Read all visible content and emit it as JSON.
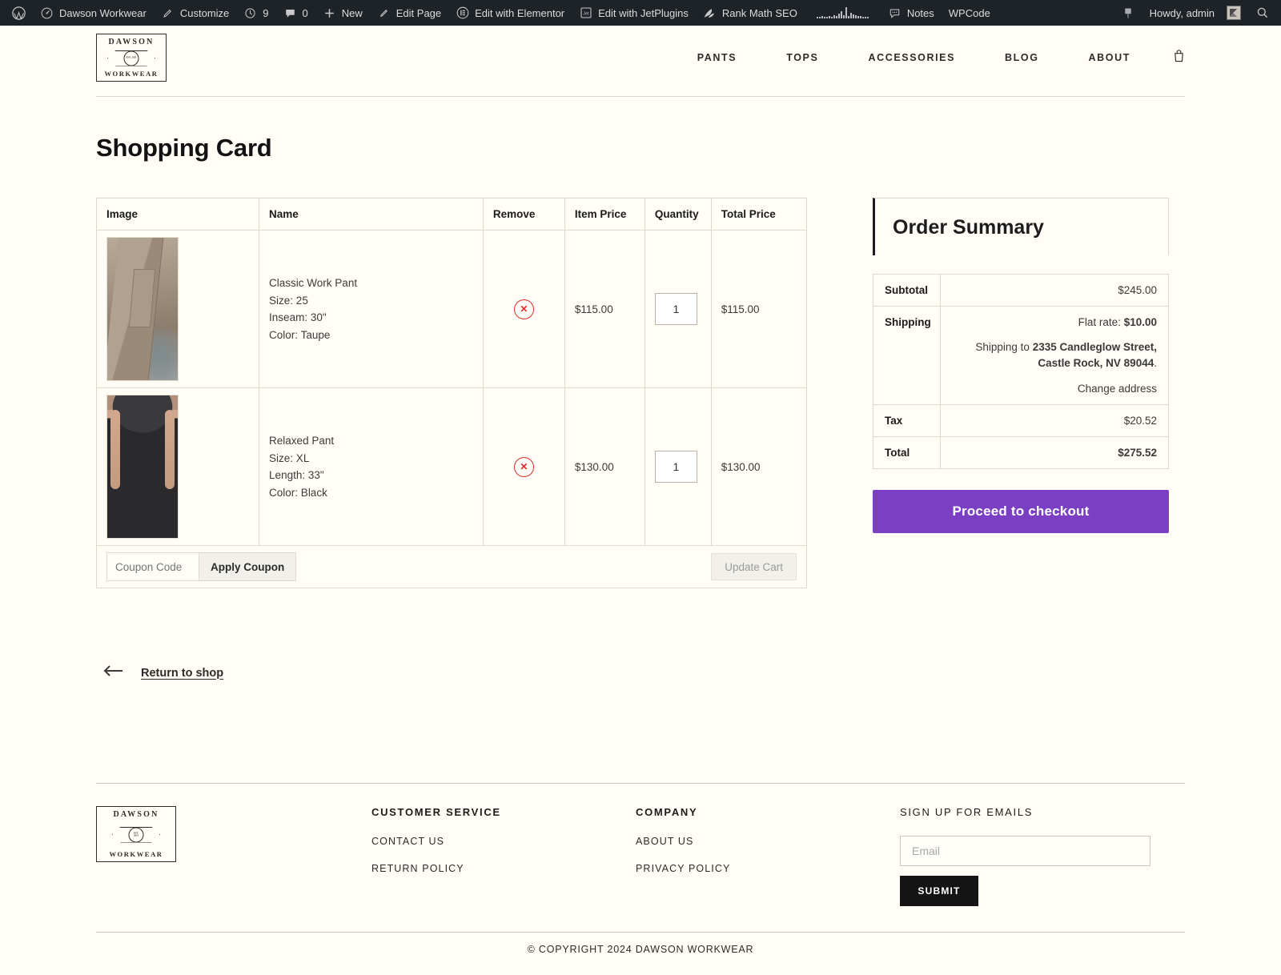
{
  "adminbar": {
    "left_items": [
      {
        "icon": "wordpress-logo-icon",
        "label": ""
      },
      {
        "icon": "dashboard-icon",
        "label": "Dawson Workwear"
      },
      {
        "icon": "paintbrush-icon",
        "label": "Customize"
      },
      {
        "icon": "updates-icon",
        "label": "9"
      },
      {
        "icon": "comment-bubble-icon",
        "label": "0"
      },
      {
        "icon": "plus-icon",
        "label": "New"
      },
      {
        "icon": "pencil-icon",
        "label": "Edit Page"
      },
      {
        "icon": "elementor-icon",
        "label": "Edit with Elementor"
      },
      {
        "icon": "jetplugins-icon",
        "label": "Edit with JetPlugins"
      },
      {
        "icon": "rankmath-icon",
        "label": "Rank Math SEO"
      },
      {
        "icon": "sparkline-icon",
        "label": ""
      },
      {
        "icon": "notes-icon",
        "label": "Notes"
      },
      {
        "icon": "wpcode-icon",
        "label": "WPCode"
      }
    ],
    "right_items": [
      {
        "icon": "pin-icon",
        "label": ""
      },
      {
        "icon": "",
        "label": "Howdy, admin"
      },
      {
        "icon": "avatar-icon",
        "label": ""
      },
      {
        "icon": "search-icon",
        "label": ""
      }
    ]
  },
  "header": {
    "logo": {
      "top": "DAWSON",
      "bottom": "WORKWEAR",
      "emblem": "EST. 2021"
    },
    "nav": [
      "PANTS",
      "TOPS",
      "ACCESSORIES",
      "BLOG",
      "ABOUT"
    ],
    "cart_icon": "shopping-bag-icon"
  },
  "page": {
    "title": "Shopping Card"
  },
  "cart": {
    "columns": [
      "Image",
      "Name",
      "Remove",
      "Item Price",
      "Quantity",
      "Total Price"
    ],
    "rows": [
      {
        "image_alt": "taupe-work-pant-photo",
        "name": "Classic Work Pant",
        "attr1": "Size: 25",
        "attr2": "Inseam: 30\"",
        "attr3": "Color: Taupe",
        "remove_icon": "remove-circle-x-icon",
        "item_price": "$115.00",
        "quantity": "1",
        "total_price": "$115.00"
      },
      {
        "image_alt": "black-relaxed-pant-photo",
        "name": "Relaxed Pant",
        "attr1": "Size: XL",
        "attr2": "Length: 33\"",
        "attr3": "Color: Black",
        "remove_icon": "remove-circle-x-icon",
        "item_price": "$130.00",
        "quantity": "1",
        "total_price": "$130.00"
      }
    ],
    "coupon_placeholder": "Coupon Code",
    "coupon_value": "",
    "apply_coupon_label": "Apply Coupon",
    "update_cart_label": "Update Cart"
  },
  "order_summary": {
    "title": "Order Summary",
    "subtotal_label": "Subtotal",
    "subtotal_value": "$245.00",
    "shipping_label": "Shipping",
    "shipping_rate_prefix": "Flat rate: ",
    "shipping_rate_value": "$10.00",
    "shipping_to_prefix": "Shipping to ",
    "shipping_address_line1": "2335 Candleglow Street,",
    "shipping_address_line2": "Castle Rock, NV 89044",
    "shipping_address_period": ".",
    "change_address_label": "Change address",
    "tax_label": "Tax",
    "tax_value": "$20.52",
    "total_label": "Total",
    "total_value": "$275.52",
    "checkout_label": "Proceed to checkout",
    "accent_color": "#7b3fc4"
  },
  "return_to_shop": {
    "icon": "arrow-left-icon",
    "label": "Return to shop"
  },
  "footer": {
    "logo": {
      "top": "DAWSON",
      "bottom": "WORKWEAR"
    },
    "customer_service": {
      "heading": "CUSTOMER SERVICE",
      "links": [
        "CONTACT US",
        "RETURN POLICY"
      ]
    },
    "company": {
      "heading": "COMPANY",
      "links": [
        "ABOUT US",
        "PRIVACY POLICY"
      ]
    },
    "newsletter": {
      "heading": "SIGN UP FOR EMAILS",
      "placeholder": "Email",
      "value": "",
      "submit_label": "SUBMIT"
    },
    "copyright": "© COPYRIGHT 2024 DAWSON WORKWEAR"
  }
}
